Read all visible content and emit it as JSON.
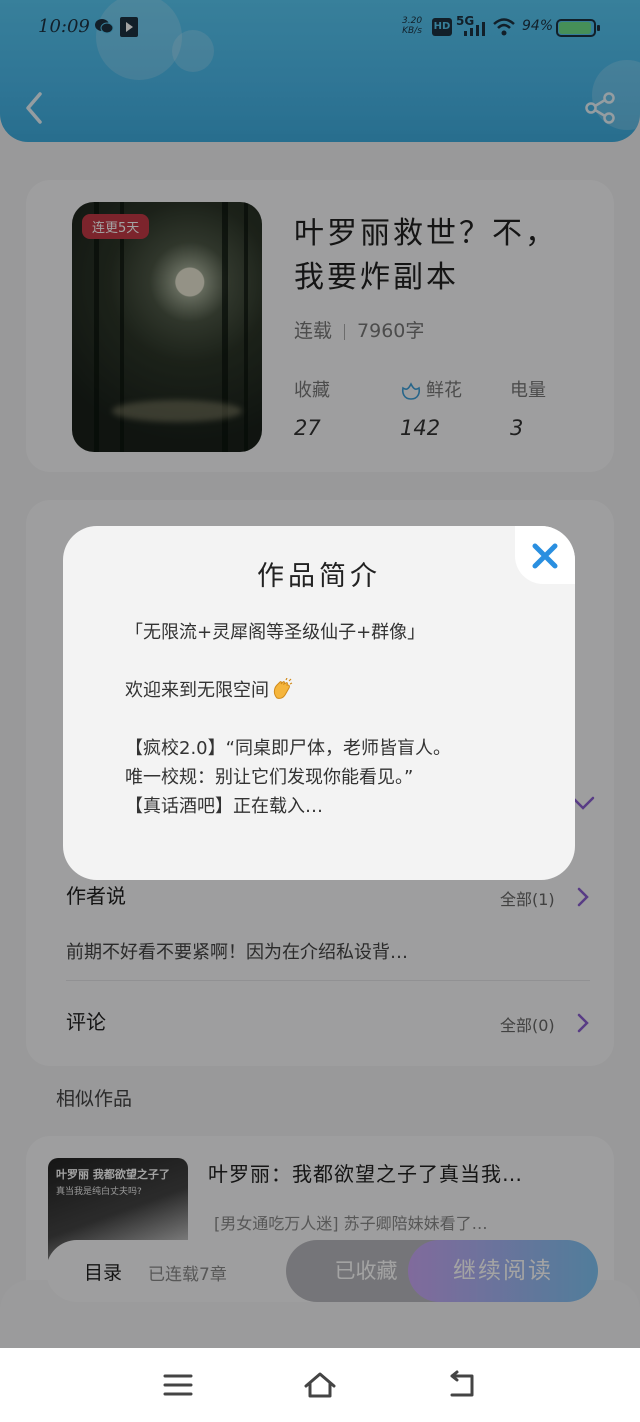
{
  "status_bar": {
    "time": "10:09",
    "net_speed_value": "3.20",
    "net_speed_unit": "KB/s",
    "hd_label": "HD",
    "network": "5G",
    "battery_percent": "94%",
    "battery_level": 0.94,
    "battery_color": "#6ee08a"
  },
  "header": {
    "back_icon": "chevron-left-icon",
    "share_icon": "share-icon",
    "accent": "#4ab8ea"
  },
  "book": {
    "badge": "连更5天",
    "title_line1": "叶罗丽救世？不，",
    "title_line2": "我要炸副本",
    "status": "连载",
    "word_count": "7960字",
    "stats": [
      {
        "label": "收藏",
        "value": "27"
      },
      {
        "label": "鲜花",
        "value": "142"
      },
      {
        "label": "电量",
        "value": "3"
      }
    ]
  },
  "author_note": {
    "title": "作者说",
    "more": "全部(1)",
    "text": "前期不好看不要紧啊！因为在介绍私设背…"
  },
  "comments": {
    "title": "评论",
    "more": "全部(0)"
  },
  "similar": {
    "section_title": "相似作品",
    "cover_line1": "叶罗丽 我都欲望之子了",
    "cover_line2": "真当我是纯白丈夫吗?",
    "title": "叶罗丽：我都欲望之子了真当我…",
    "desc": "[男女通吃万人迷] 苏子卿陪妹妹看了…"
  },
  "action_bar": {
    "toc": "目录",
    "chapters": "已连载7章",
    "collected": "已收藏",
    "continue": "继续阅读"
  },
  "modal": {
    "title": "作品简介",
    "line1": "「无限流+灵犀阁等圣级仙子+群像」",
    "line2": "欢迎来到无限空间",
    "line3": "【疯校2.0】“同桌即尸体，老师皆盲人。",
    "line4": "唯一校规：别让它们发现你能看见。”",
    "line5": "【真话酒吧】正在载入…",
    "close_icon": "close-icon",
    "close_color": "#2a8fe0"
  },
  "nav": {
    "menu_icon": "menu-icon",
    "home_icon": "home-icon",
    "back_icon": "back-icon"
  }
}
